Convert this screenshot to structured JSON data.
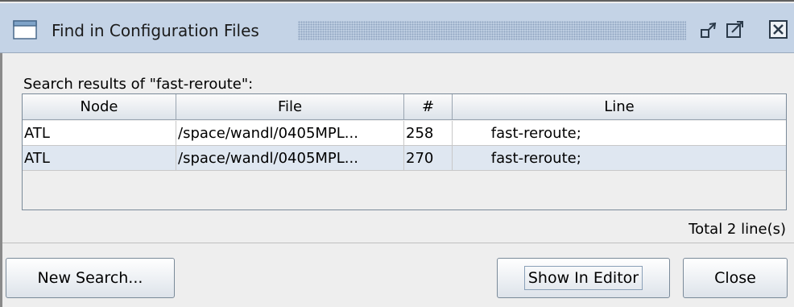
{
  "window": {
    "title": "Find in Configuration Files",
    "icons": [
      "window-icon",
      "minimize-icon",
      "maximize-icon",
      "close-icon"
    ]
  },
  "search": {
    "label": "Search results of \"fast-reroute\":"
  },
  "table": {
    "columns": [
      "Node",
      "File",
      "#",
      "Line"
    ],
    "rows": [
      {
        "node": "ATL",
        "file": "/space/wandl/0405MPL...",
        "num": "258",
        "line": "        fast-reroute;"
      },
      {
        "node": "ATL",
        "file": "/space/wandl/0405MPL...",
        "num": "270",
        "line": "        fast-reroute;"
      }
    ]
  },
  "status": {
    "total": "Total 2 line(s)"
  },
  "buttons": {
    "new_search": "New Search...",
    "show_in_editor": "Show In Editor",
    "close": "Close"
  },
  "colors": {
    "titlebar": "#c4d3e6",
    "selected_row": "#dfe7f1",
    "background": "#eeeeee"
  }
}
